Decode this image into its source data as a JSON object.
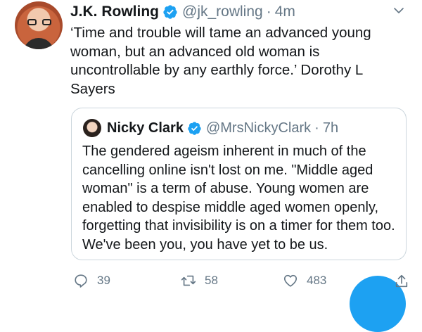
{
  "tweet": {
    "name": "J.K. Rowling",
    "handle": "@jk_rowling",
    "separator": "·",
    "time": "4m",
    "text": "‘Time and trouble will tame an advanced young woman, but an advanced old woman is uncontrollable by any earthly force.’ Dorothy L Sayers"
  },
  "quote": {
    "name": "Nicky Clark",
    "handle": "@MrsNickyClark",
    "separator": "·",
    "time": "7h",
    "text": "The gendered ageism inherent in much of the cancelling online isn't lost on me. \"Middle aged woman\" is a term of abuse. Young women are enabled to despise middle aged women openly, forgetting that invisibility is on a timer for them too. We've been you, you have yet to be us."
  },
  "actions": {
    "reply_count": "39",
    "retweet_count": "58",
    "like_count": "483"
  },
  "colors": {
    "accent": "#1da1f2",
    "secondary_text": "#657786",
    "border": "#ccd6dd"
  },
  "icons": [
    "verified-badge-icon",
    "chevron-down-icon",
    "reply-icon",
    "retweet-icon",
    "like-icon",
    "share-icon"
  ]
}
